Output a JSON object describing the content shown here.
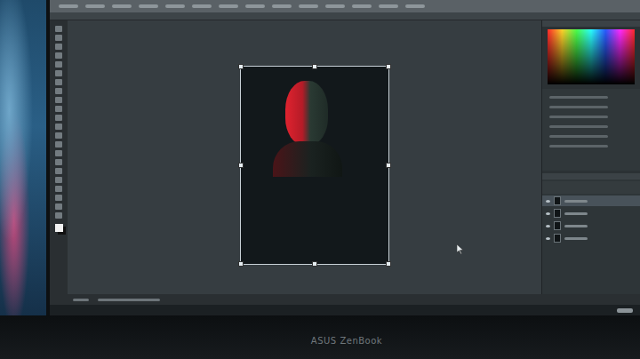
{
  "laptop": {
    "brand": "ASUS ZenBook"
  },
  "document": {
    "transform_active": true
  },
  "layers": [
    {
      "visible": true,
      "selected": true
    },
    {
      "visible": true,
      "selected": false
    },
    {
      "visible": true,
      "selected": false
    },
    {
      "visible": true,
      "selected": false
    }
  ]
}
